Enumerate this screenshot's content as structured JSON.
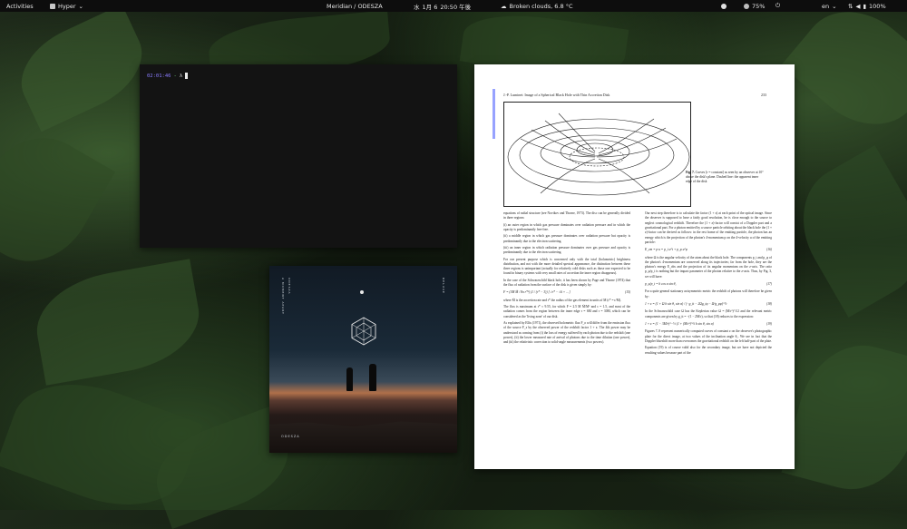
{
  "topbar": {
    "activities": "Activities",
    "app_name": "Hyper",
    "now_playing": "Meridian / ODESZA",
    "clock": {
      "icon_text": "水",
      "date": "1月 6",
      "time": "20:50 午後"
    },
    "weather": "Broken clouds, 6.8 °C",
    "battery_percent": "75%",
    "language": "en",
    "battery_total": "100%",
    "accent_color": "#8a7cff"
  },
  "terminal": {
    "prompt_time": "02:01:46",
    "prompt_separator": "-",
    "prompt_symbol": "λ"
  },
  "album": {
    "title_vertical_1": "A MOMENT APART",
    "title_vertical_2": "ODESZA",
    "badge": "DELUXE",
    "brand": "ODESZA"
  },
  "document": {
    "header": "J.-P. Luminet: Image of a Spherical Black Hole with Thin Accretion Disk",
    "page_number": "233",
    "caption_label": "Fig. 7.",
    "caption_text": "Curves [r = constant] as seen by an observer at 10° above the disk's plane. Dashed line: the apparent inner edge of the disk",
    "left_column": [
      "equations of radial structure (see Novikov and Thorne, 1973). The disc can be generally divided in three regions:",
      "(i) an outer region in which gas pressure dominates over radiation pressure and in which the opacity is predominantly free-free.",
      "(ii) a middle region in which gas pressure dominates over radiation pressure but opacity is predominantly due to the electron scattering.",
      "(iii) an inner region in which radiation pressure dominates over gas pressure and opacity is predominantly due to the electron scattering.",
      "For our present purpose which is concerned only with the total (bolometric) brightness distribution, and not with the more detailed spectral appearance, the distinction between these three regions is unimportant (actually for relatively cold disks such as those one expected to be found in binary systems with very small rates of accretion the inner region disappears).",
      "In the case of the Schwarzschild black hole, it has been shown by Page and Thorne (1974) that the flux of radiation from the surface of the disk is given simply by:",
      "where Ṁ is the accretion rate and r* the radius of the gas element in units of M (r* = r/M).",
      "The flux is maximum at r* ≈ 9.55, for which F = 2.5 M Ṁ/M² and c = 1.5, and most of the radiation comes from the region between the inner edge r = 6M and r = 30M, which can be considered as the 'living zone' of our disk.",
      "As explained by Ellis (1971), the observed bolometric flux F_o will differ from the emission flux of the source F_s by the observed power of the redshift factor 1 + z. The 4th power may be understood as coming from (i) the loss of energy suffered by each photon due to the redshift (one power), (ii) the lower measured rate of arrival of photons due to the time dilation (one power), and (iii) the relativistic correction to solid-angle measurements (two powers)."
    ],
    "right_column": [
      "Our next step therefore is to calculate the factor (1 + z) at each point of the optical image. Since the observer is supposed to have a fairly good resolution, he is close enough to the source to neglect cosmological redshift. Therefore the (1 + z)-factor will consist of a Doppler part and a gravitational part. For a photon emitted by a source particle orbiting about the black hole the (1 + z)-factor can be derived as follows: in the rest frame of the emitting particle, the photon has an energy which is the projection of the photon's 4-momentum p on the 4-velocity u of the emitting particle:",
      "where Ω is the angular velocity of the atom about the black hole. The components p_t and p_φ of the photon's 4-momentum are conserved along its trajectories; far from the hole, they are the photon's energy E_obs and the projection of its angular momentum on the z-axis. The ratio p_φ/p_t is nothing but the impact parameter of the photon relative to the z-axis. Thus, by Fig. 3, we will have:",
      "For a quite general stationary axisymmetric metric the redshift of photons will therefore be given by:",
      "In the Schwarzschild case Ω has the Keplerian value Ω = (M/r³)^1/2 and the relevant metric components are given by g_tt = −(1 − 2M/r), so that (18) reduces to the expression:",
      "Figures 7–9 represent numerically computed curves of constant z on the observer's photographic plate for the direct image, at two values of the inclination angle θ₀. We see in fact that the Doppler blueshift more than overcomes the gravitational redshift on the left half-part of the plate.",
      "Equation (19) is of course valid also for the secondary image, but we have not depicted the resulting values because part of the"
    ],
    "equations_left": [
      "(15)"
    ],
    "equations_right": [
      "(16)",
      "(17)",
      "(18)",
      "(19)"
    ]
  }
}
